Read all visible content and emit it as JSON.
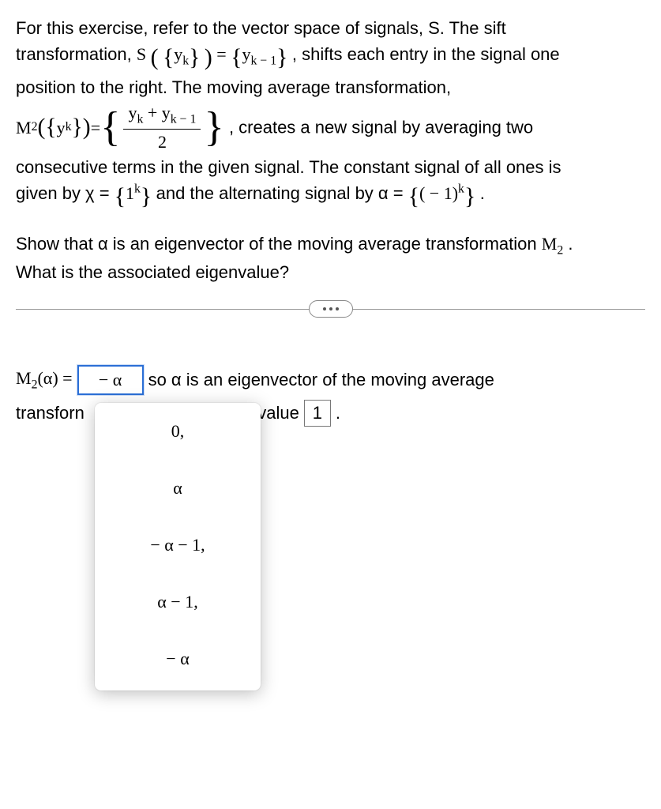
{
  "intro": {
    "line1a": "For this exercise, refer to the vector space of signals, S. The sift",
    "line1b": "transformation, ",
    "sift_lhs_S": "S",
    "brace_open": "(",
    "yk": "y",
    "yk_sub": "k",
    "brace_close": ")",
    "eq": " = ",
    "yk1": "y",
    "yk1_sub": "k − 1",
    "line1c": ", shifts each entry in the signal one",
    "line2": "position to the right. The moving average transformation,",
    "m2": "M",
    "m2_sub": "2",
    "frac_num_a": "y",
    "frac_num_a_sub": "k",
    "plus": " + ",
    "frac_num_b": "y",
    "frac_num_b_sub": "k − 1",
    "frac_den": "2",
    "line3": ", creates a new signal by averaging two",
    "line4": "consecutive terms in the given signal. The constant signal of all ones is",
    "line5a": "given by χ = ",
    "ones_inner": "1",
    "ones_sup": "k",
    "line5b": " and the alternating signal by α = ",
    "alt_inner": "( − 1)",
    "alt_sup": "k",
    "period": "."
  },
  "prompt": {
    "line1a": "Show that α is an eigenvector of the moving average transformation ",
    "m2": "M",
    "m2_sub": "2",
    "line1b": ".",
    "line2": "What is the associated eigenvalue?"
  },
  "answer": {
    "m2": "M",
    "m2_sub": "2",
    "alpha_arg": "(α) = ",
    "selected": "− α",
    "tail1": " so α is an eigenvector of the moving average",
    "line2a": "transforn",
    "line2b": "nvalue ",
    "eigen_value": "1",
    "line2c": "."
  },
  "dropdown": {
    "options": [
      "0,",
      "α",
      "− α − 1,",
      "α − 1,",
      "− α"
    ]
  }
}
